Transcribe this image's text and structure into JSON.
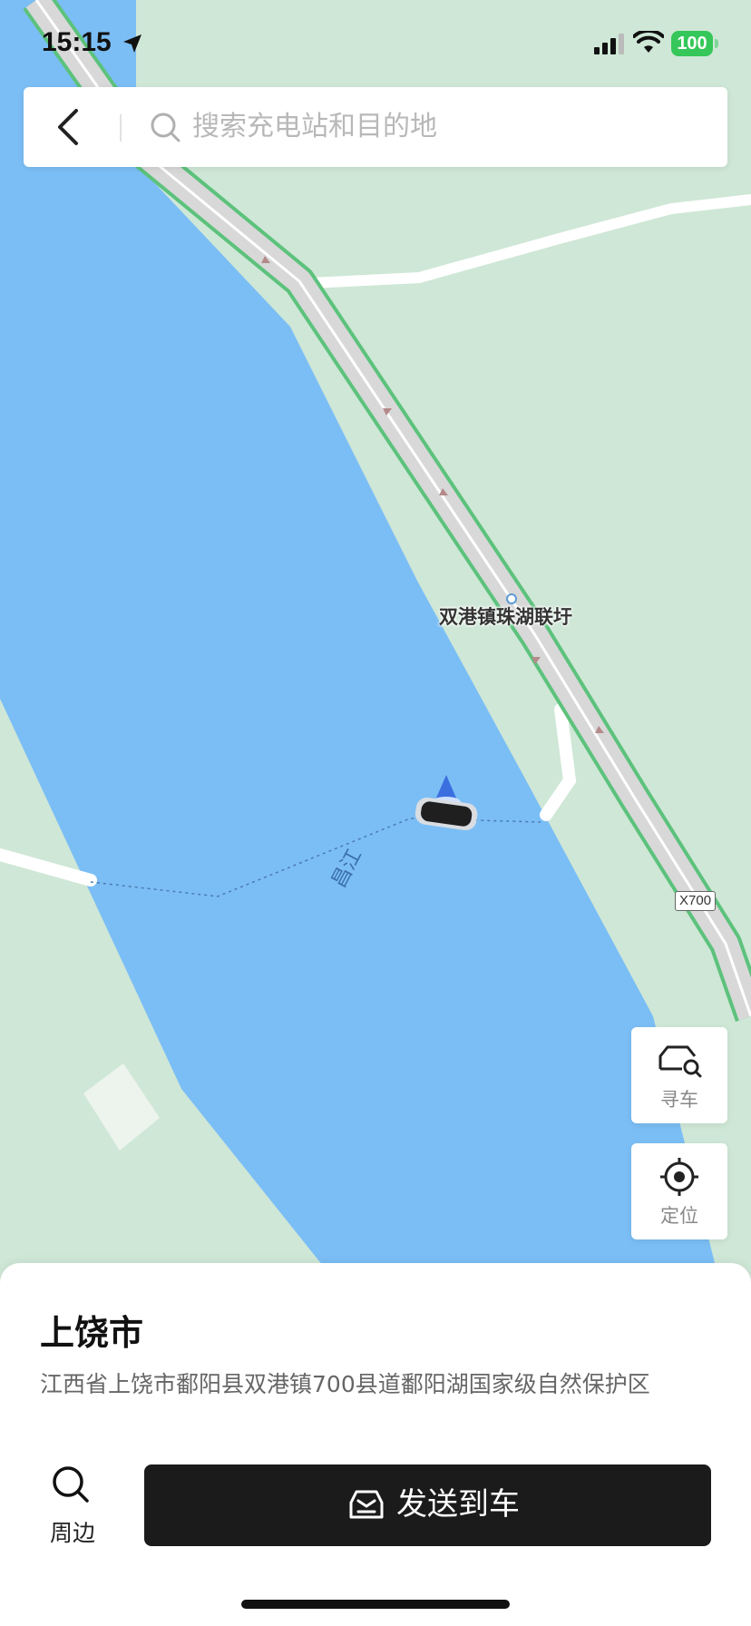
{
  "status_bar": {
    "time": "15:15",
    "battery": "100"
  },
  "search": {
    "placeholder": "搜索充电站和目的地"
  },
  "map": {
    "place_label": "双港镇珠湖联圩",
    "road_tag": "X700",
    "river_label": "昌江",
    "water_color": "#7bbef5",
    "land_color": "#cfe7d6",
    "road_border_color": "#5cc27c"
  },
  "side_buttons": {
    "find_car": "寻车",
    "locate": "定位"
  },
  "sheet": {
    "title": "上饶市",
    "address": "江西省上饶市鄱阳县双港镇700县道鄱阳湖国家级自然保护区",
    "nearby_label": "周边",
    "send_label": "发送到车"
  }
}
